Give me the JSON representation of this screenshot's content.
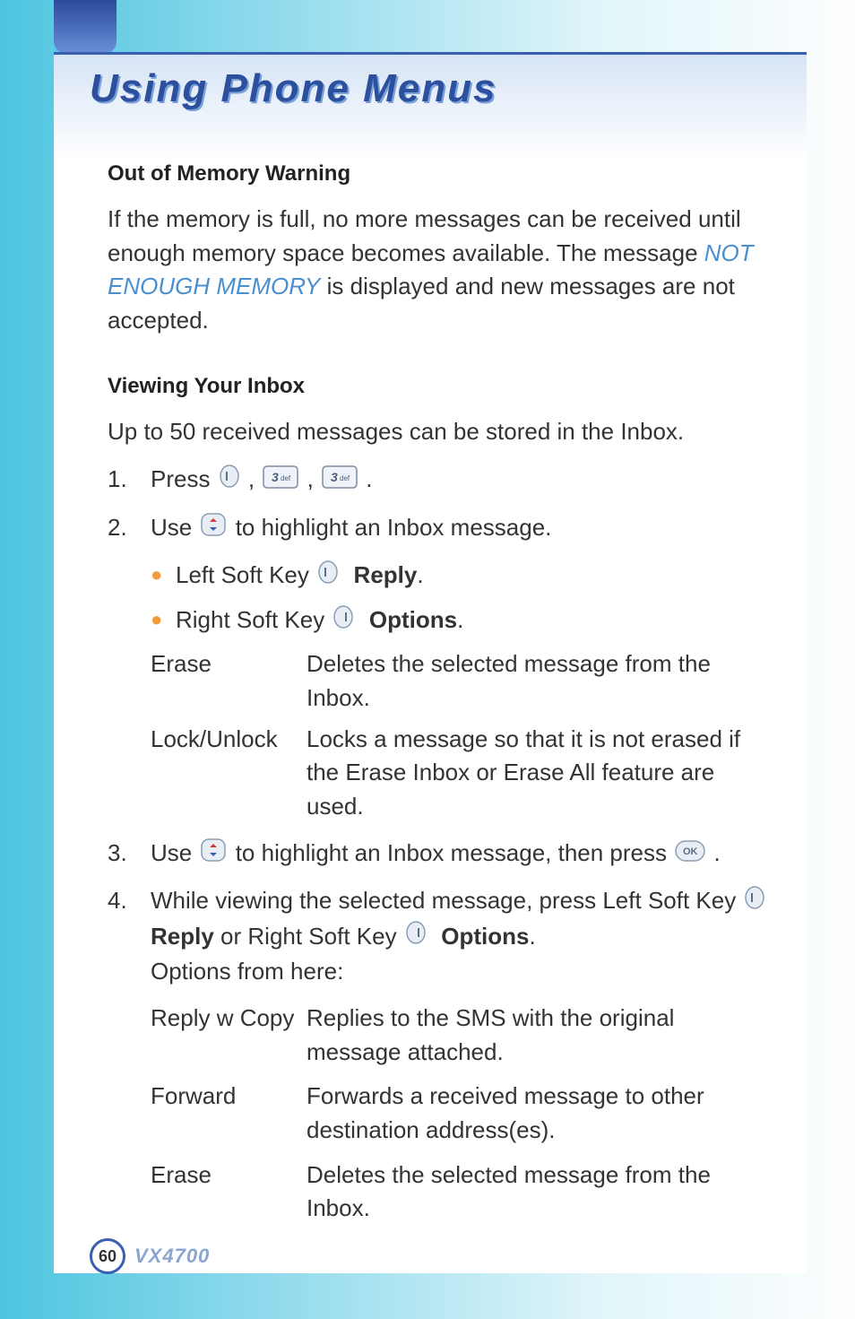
{
  "heading": "Using Phone Menus",
  "section1": {
    "title": "Out of Memory Warning",
    "para_pre": "If the memory is full, no more messages can be received until enough memory space becomes available. The message ",
    "para_italic": "NOT ENOUGH MEMORY",
    "para_post": " is displayed and new messages are not accepted."
  },
  "section2": {
    "title": "Viewing Your Inbox",
    "intro": "Up to 50 received messages can be stored in the Inbox.",
    "step1_num": "1.",
    "step1_pre": "Press ",
    "step1_sep": " , ",
    "step1_end": " .",
    "step2_num": "2.",
    "step2_pre": "Use ",
    "step2_post": " to highlight an Inbox message.",
    "leftkey_pre": "Left Soft Key ",
    "leftkey_bold": "Reply",
    "leftkey_dot": ".",
    "rightkey_pre": "Right Soft Key ",
    "rightkey_bold": "Options",
    "rightkey_dot": ".",
    "erase_term": "Erase",
    "erase_body": "Deletes the selected message from the Inbox.",
    "lock_term": "Lock/Unlock",
    "lock_body": "Locks a message so that it is not erased if the Erase Inbox or Erase All feature are used.",
    "step3_num": "3.",
    "step3_pre": "Use ",
    "step3_mid": " to highlight an Inbox message, then press ",
    "step3_end": " .",
    "step4_num": "4.",
    "step4_pre": "While viewing the selected message, press Left Soft Key ",
    "step4_reply": "Reply",
    "step4_mid": " or Right Soft Key ",
    "step4_options": "Options",
    "step4_dot": ".",
    "step4_line2": "Options from here:",
    "replycopy_term": "Reply w Copy",
    "replycopy_body": "Replies to the SMS with the original message attached.",
    "forward_term": "Forward",
    "forward_body": "Forwards a received message to other destination address(es).",
    "erase2_term": "Erase",
    "erase2_body": "Deletes the selected message from the Inbox."
  },
  "footer": {
    "page": "60",
    "model": "VX4700"
  },
  "icons": {
    "softkey_left": "left-softkey-icon",
    "softkey_right": "right-softkey-icon",
    "key3": "keypad-3-icon",
    "updown": "up-down-nav-icon",
    "ok": "ok-key-icon"
  }
}
